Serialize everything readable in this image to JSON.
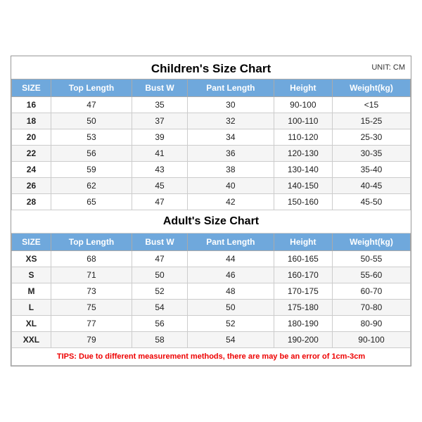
{
  "chart": {
    "main_title": "Children's Size Chart",
    "unit": "UNIT: CM",
    "children_headers": [
      "SIZE",
      "Top Length",
      "Bust W",
      "Pant Length",
      "Height",
      "Weight(kg)"
    ],
    "children_rows": [
      [
        "16",
        "47",
        "35",
        "30",
        "90-100",
        "<15"
      ],
      [
        "18",
        "50",
        "37",
        "32",
        "100-110",
        "15-25"
      ],
      [
        "20",
        "53",
        "39",
        "34",
        "110-120",
        "25-30"
      ],
      [
        "22",
        "56",
        "41",
        "36",
        "120-130",
        "30-35"
      ],
      [
        "24",
        "59",
        "43",
        "38",
        "130-140",
        "35-40"
      ],
      [
        "26",
        "62",
        "45",
        "40",
        "140-150",
        "40-45"
      ],
      [
        "28",
        "65",
        "47",
        "42",
        "150-160",
        "45-50"
      ]
    ],
    "adult_title": "Adult's Size Chart",
    "adult_headers": [
      "SIZE",
      "Top Length",
      "Bust W",
      "Pant Length",
      "Height",
      "Weight(kg)"
    ],
    "adult_rows": [
      [
        "XS",
        "68",
        "47",
        "44",
        "160-165",
        "50-55"
      ],
      [
        "S",
        "71",
        "50",
        "46",
        "160-170",
        "55-60"
      ],
      [
        "M",
        "73",
        "52",
        "48",
        "170-175",
        "60-70"
      ],
      [
        "L",
        "75",
        "54",
        "50",
        "175-180",
        "70-80"
      ],
      [
        "XL",
        "77",
        "56",
        "52",
        "180-190",
        "80-90"
      ],
      [
        "XXL",
        "79",
        "58",
        "54",
        "190-200",
        "90-100"
      ]
    ],
    "tips": "TIPS: Due to different measurement methods, there are may be an error of 1cm-3cm"
  }
}
